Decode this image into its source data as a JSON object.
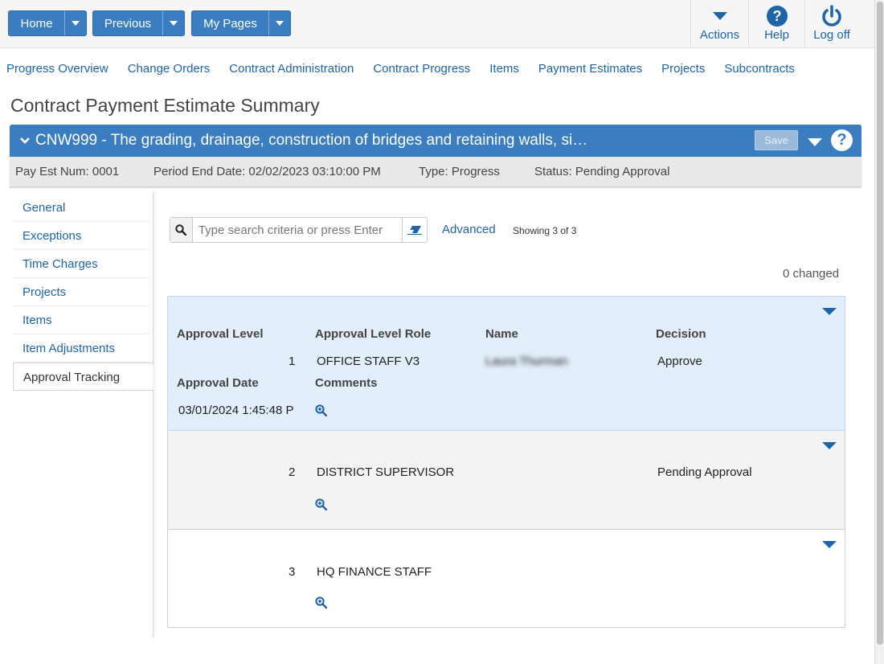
{
  "topbar": {
    "home_label": "Home",
    "previous_label": "Previous",
    "my_pages_label": "My Pages",
    "actions_label": "Actions",
    "help_label": "Help",
    "logoff_label": "Log off"
  },
  "nav_links": [
    "Progress Overview",
    "Change Orders",
    "Contract Administration",
    "Contract Progress",
    "Items",
    "Payment Estimates",
    "Projects",
    "Subcontracts"
  ],
  "page_title": "Contract Payment Estimate Summary",
  "header": {
    "title": "CNW999 - The grading, drainage, construction of bridges and retaining walls, si…",
    "save_label": "Save",
    "help_glyph": "?"
  },
  "info": {
    "pay_est_num": "Pay Est Num: 0001",
    "period_end": "Period End Date: 02/02/2023 03:10:00 PM",
    "type": "Type: Progress",
    "status": "Status: Pending Approval"
  },
  "sidebar": {
    "items": [
      "General",
      "Exceptions",
      "Time Charges",
      "Projects",
      "Items",
      "Item Adjustments",
      "Approval Tracking"
    ],
    "active_index": 6
  },
  "search": {
    "placeholder": "Type search criteria or press Enter",
    "value": "",
    "advanced_label": "Advanced",
    "showing": "Showing 3 of 3"
  },
  "changed_label": "0 changed",
  "columns": {
    "approval_level": "Approval Level",
    "approval_level_role": "Approval Level Role",
    "name": "Name",
    "decision": "Decision",
    "approval_date": "Approval Date",
    "comments": "Comments"
  },
  "rows": [
    {
      "level": "1",
      "role": "OFFICE STAFF V3",
      "name": "Laura Thurman",
      "decision": "Approve",
      "date": "03/01/2024 1:45:48 P"
    },
    {
      "level": "2",
      "role": "DISTRICT SUPERVISOR",
      "name": "",
      "decision": "Pending Approval",
      "date": ""
    },
    {
      "level": "3",
      "role": "HQ FINANCE STAFF",
      "name": "",
      "decision": "",
      "date": ""
    }
  ],
  "colors": {
    "primary": "#3a7dc0",
    "link": "#1d64a8",
    "selected_row": "#e2eefa"
  },
  "icons": {
    "actions": "caret-down-icon",
    "help": "question-circle-icon",
    "logoff": "power-icon",
    "search": "magnifier-icon",
    "clear": "eraser-icon",
    "comments": "zoom-in-icon"
  }
}
